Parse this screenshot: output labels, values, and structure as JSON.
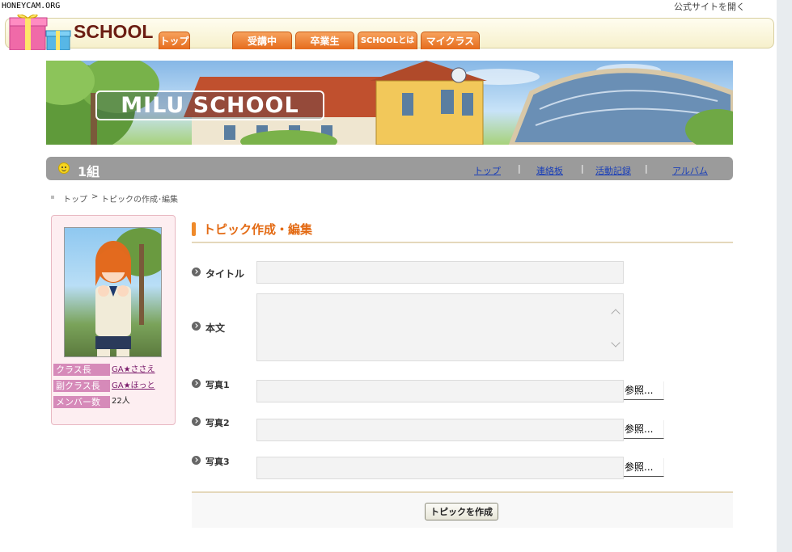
{
  "watermark": "HONEYCAM.ORG",
  "top_link": "公式サイトを開く",
  "logo": {
    "text": "SCHOOL"
  },
  "tabs": [
    {
      "label": "トップ"
    },
    {
      "label": "受講中"
    },
    {
      "label": "卒業生"
    },
    {
      "label": "SCHOOLとは"
    },
    {
      "label": "マイクラス"
    }
  ],
  "banner": {
    "title": "MILU SCHOOL"
  },
  "class_bar": {
    "name": "1組",
    "links": [
      {
        "label": "トップ"
      },
      {
        "label": "連絡板"
      },
      {
        "label": "活動記録"
      },
      {
        "label": "アルバム"
      }
    ],
    "separator": "|"
  },
  "breadcrumb": {
    "home": "トップ",
    "separator": ">",
    "current": "トピックの作成･編集"
  },
  "sidebar": {
    "rows": [
      {
        "label": "クラス長",
        "value": "GA★ささえ"
      },
      {
        "label": "副クラス長",
        "value": "GA★ほっと"
      },
      {
        "label": "メンバー数",
        "value": "22人"
      }
    ]
  },
  "form": {
    "heading": "トピック作成・編集",
    "title_label": "タイトル",
    "title_value": "",
    "body_label": "本文",
    "body_value": "",
    "photos": [
      {
        "label": "写真1",
        "button": "参照..."
      },
      {
        "label": "写真2",
        "button": "参照..."
      },
      {
        "label": "写真3",
        "button": "参照..."
      }
    ],
    "submit": "トピックを作成"
  },
  "colors": {
    "accent_orange": "#e36a13",
    "tab_orange": "#e56b1c",
    "class_bar_gray": "#9b9b9b",
    "label_pink": "#d68ab9",
    "link_blue": "#1a3fb8"
  }
}
